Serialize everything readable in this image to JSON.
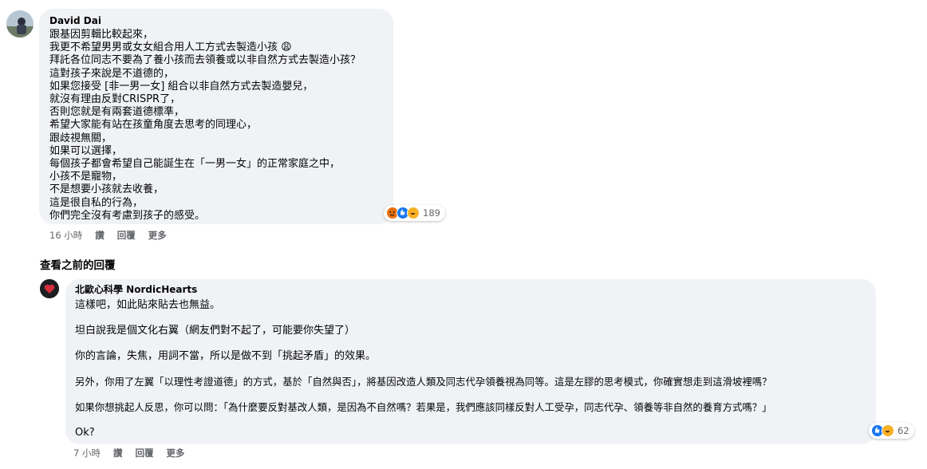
{
  "comment1": {
    "author": "David Dai",
    "lines": [
      "跟基因剪輯比較起來，",
      "我更不希望男男或女女組合用人工方式去製造小孩 😩",
      "拜託各位同志不要為了養小孩而去領養或以非自然方式去製造小孩？",
      "這對孩子來說是不道德的，",
      "如果您接受 [非一男一女] 組合以非自然方式去製造嬰兒，",
      "就沒有理由反對CRISPR了，",
      "否則您就是有兩套道德標準，",
      "希望大家能有站在孩童角度去思考的同理心，",
      "跟歧視無關，",
      "如果可以選擇，",
      "每個孩子都會希望自己能誕生在「一男一女」的正常家庭之中，",
      "小孩不是寵物，",
      "不是想要小孩就去收養，",
      "這是很自私的行為，",
      "你們完全沒有考慮到孩子的感受。"
    ],
    "reactions": {
      "icons": [
        "angry-icon",
        "like-icon",
        "haha-icon"
      ],
      "count": "189"
    },
    "actions": {
      "time": "16 小時",
      "like": "讚",
      "reply": "回覆",
      "more": "更多"
    }
  },
  "view_previous_label": "查看之前的回覆",
  "comment2": {
    "author": "北歐心科學 NordicHearts",
    "paragraphs": [
      "這樣吧，如此貼來貼去也無益。",
      "坦白說我是個文化右翼（網友們對不起了，可能要你失望了）",
      "你的言論，失焦，用詞不當，所以是做不到「挑起矛盾」的效果。",
      "另外，你用了左翼「以理性考證道德」的方式，基於「自然與否」，將基因改造人類及同志代孕領養視為同等。這是左膠的思考模式，你確實想走到這滑坡裡嗎？",
      "如果你想挑起人反思，你可以問：「為什麼要反對基改人類，是因為不自然嗎？若果是，我們應該同樣反對人工受孕，同志代孕、領養等非自然的養育方式嗎？」",
      "Ok?"
    ],
    "reactions": {
      "icons": [
        "like-icon",
        "haha-icon"
      ],
      "count": "62"
    },
    "actions": {
      "time": "7 小時",
      "like": "讚",
      "reply": "回覆",
      "more": "更多"
    }
  },
  "colors": {
    "bubble": "#f0f2f5",
    "secondary_text": "#65676b",
    "like_blue": "#1877f2",
    "angry_orange": "#e9710f",
    "haha_yellow": "#f7b125"
  }
}
